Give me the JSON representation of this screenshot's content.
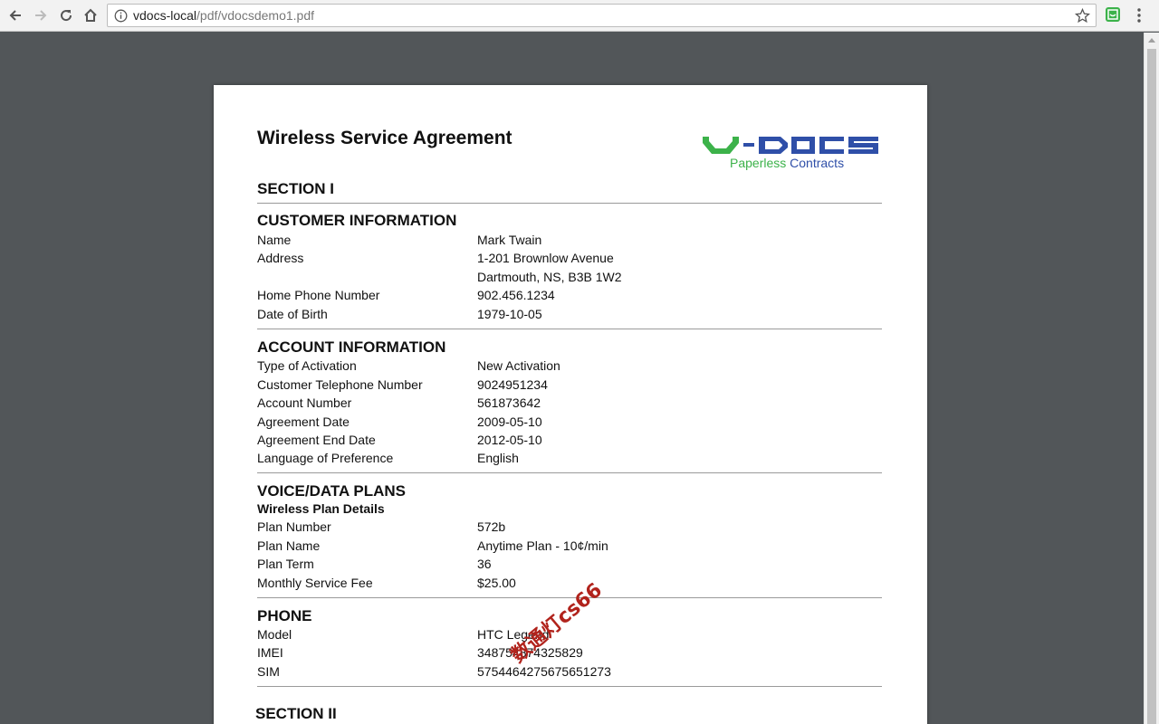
{
  "browser": {
    "url_host": "vdocs-local",
    "url_path": "/pdf/vdocsdemo1.pdf",
    "back_icon": "back-arrow-icon",
    "forward_icon": "forward-arrow-icon",
    "reload_icon": "reload-icon",
    "home_icon": "home-icon"
  },
  "document": {
    "title": "Wireless Service Agreement",
    "logo_text": "V-DOCS",
    "logo_tag_green": "Paperless",
    "logo_tag_blue": "Contracts",
    "section1": "SECTION I",
    "section2": "SECTION II",
    "customer": {
      "heading": "CUSTOMER INFORMATION",
      "rows": [
        {
          "label": "Name",
          "value": "Mark Twain"
        },
        {
          "label": "Address",
          "value": "1-201 Brownlow Avenue"
        },
        {
          "label": "",
          "value": "Dartmouth, NS, B3B 1W2"
        },
        {
          "label": "Home Phone Number",
          "value": "902.456.1234"
        },
        {
          "label": "Date of Birth",
          "value": "1979-10-05"
        }
      ]
    },
    "account": {
      "heading": "ACCOUNT INFORMATION",
      "rows": [
        {
          "label": "Type of Activation",
          "value": "New Activation"
        },
        {
          "label": "Customer Telephone Number",
          "value": "9024951234"
        },
        {
          "label": "Account Number",
          "value": "561873642"
        },
        {
          "label": "Agreement Date",
          "value": "2009-05-10"
        },
        {
          "label": "Agreement End Date",
          "value": "2012-05-10"
        },
        {
          "label": "Language of Preference",
          "value": "English"
        }
      ]
    },
    "plans": {
      "heading": "VOICE/DATA PLANS",
      "subheading": "Wireless Plan Details",
      "rows": [
        {
          "label": "Plan Number",
          "value": "572b"
        },
        {
          "label": "Plan Name",
          "value": "Anytime Plan - 10¢/min"
        },
        {
          "label": "Plan Term",
          "value": "36"
        },
        {
          "label": "Monthly Service Fee",
          "value": "$25.00"
        }
      ]
    },
    "phone": {
      "heading": "PHONE",
      "rows": [
        {
          "label": "Model",
          "value": "HTC Legend"
        },
        {
          "label": "IMEI",
          "value": "348754874325829"
        },
        {
          "label": "SIM",
          "value": "5754464275675651273"
        }
      ]
    }
  },
  "watermark": "数通灯cs66"
}
